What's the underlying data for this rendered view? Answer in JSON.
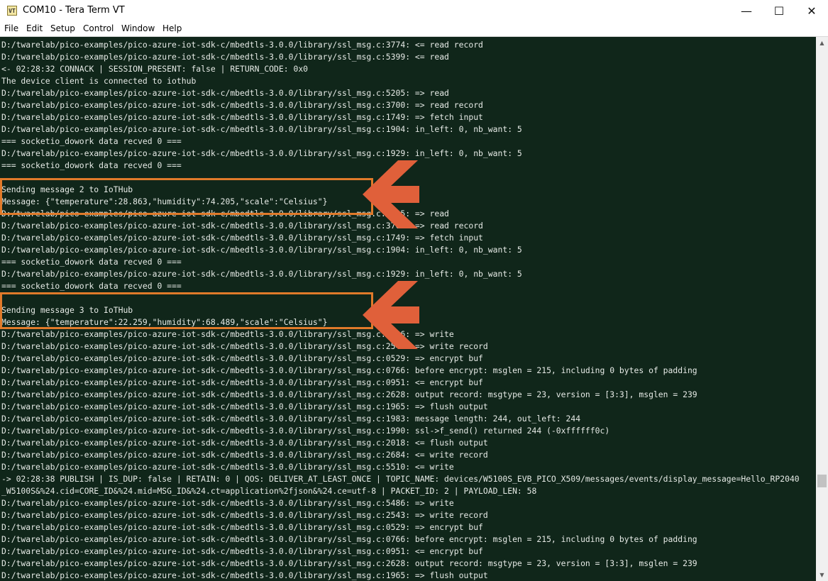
{
  "window": {
    "title": "COM10 - Tera Term VT",
    "icon_text": "VT",
    "minimize_glyph": "—",
    "maximize_glyph": "☐",
    "close_glyph": "✕"
  },
  "menu": {
    "file": "File",
    "edit": "Edit",
    "setup": "Setup",
    "control": "Control",
    "window": "Window",
    "help": "Help"
  },
  "terminal": {
    "lines": [
      "D:/twarelab/pico-examples/pico-azure-iot-sdk-c/mbedtls-3.0.0/library/ssl_msg.c:3774: <= read record",
      "D:/twarelab/pico-examples/pico-azure-iot-sdk-c/mbedtls-3.0.0/library/ssl_msg.c:5399: <= read",
      "<- 02:28:32 CONNACK | SESSION_PRESENT: false | RETURN_CODE: 0x0",
      "The device client is connected to iothub",
      "D:/twarelab/pico-examples/pico-azure-iot-sdk-c/mbedtls-3.0.0/library/ssl_msg.c:5205: => read",
      "D:/twarelab/pico-examples/pico-azure-iot-sdk-c/mbedtls-3.0.0/library/ssl_msg.c:3700: => read record",
      "D:/twarelab/pico-examples/pico-azure-iot-sdk-c/mbedtls-3.0.0/library/ssl_msg.c:1749: => fetch input",
      "D:/twarelab/pico-examples/pico-azure-iot-sdk-c/mbedtls-3.0.0/library/ssl_msg.c:1904: in_left: 0, nb_want: 5",
      "=== socketio_dowork data recved 0 ===",
      "D:/twarelab/pico-examples/pico-azure-iot-sdk-c/mbedtls-3.0.0/library/ssl_msg.c:1929: in_left: 0, nb_want: 5",
      "=== socketio_dowork data recved 0 ===",
      "",
      "Sending message 2 to IoTHub",
      "Message: {\"temperature\":28.863,\"humidity\":74.205,\"scale\":\"Celsius\"}",
      "D:/twarelab/pico-examples/pico-azure-iot-sdk-c/mbedtls-3.0.0/library/ssl_msg.c:5205: => read",
      "D:/twarelab/pico-examples/pico-azure-iot-sdk-c/mbedtls-3.0.0/library/ssl_msg.c:3700: => read record",
      "D:/twarelab/pico-examples/pico-azure-iot-sdk-c/mbedtls-3.0.0/library/ssl_msg.c:1749: => fetch input",
      "D:/twarelab/pico-examples/pico-azure-iot-sdk-c/mbedtls-3.0.0/library/ssl_msg.c:1904: in_left: 0, nb_want: 5",
      "=== socketio_dowork data recved 0 ===",
      "D:/twarelab/pico-examples/pico-azure-iot-sdk-c/mbedtls-3.0.0/library/ssl_msg.c:1929: in_left: 0, nb_want: 5",
      "=== socketio_dowork data recved 0 ===",
      "",
      "Sending message 3 to IoTHub",
      "Message: {\"temperature\":22.259,\"humidity\":68.489,\"scale\":\"Celsius\"}",
      "D:/twarelab/pico-examples/pico-azure-iot-sdk-c/mbedtls-3.0.0/library/ssl_msg.c:5486: => write",
      "D:/twarelab/pico-examples/pico-azure-iot-sdk-c/mbedtls-3.0.0/library/ssl_msg.c:2543: => write record",
      "D:/twarelab/pico-examples/pico-azure-iot-sdk-c/mbedtls-3.0.0/library/ssl_msg.c:0529: => encrypt buf",
      "D:/twarelab/pico-examples/pico-azure-iot-sdk-c/mbedtls-3.0.0/library/ssl_msg.c:0766: before encrypt: msglen = 215, including 0 bytes of padding",
      "D:/twarelab/pico-examples/pico-azure-iot-sdk-c/mbedtls-3.0.0/library/ssl_msg.c:0951: <= encrypt buf",
      "D:/twarelab/pico-examples/pico-azure-iot-sdk-c/mbedtls-3.0.0/library/ssl_msg.c:2628: output record: msgtype = 23, version = [3:3], msglen = 239",
      "D:/twarelab/pico-examples/pico-azure-iot-sdk-c/mbedtls-3.0.0/library/ssl_msg.c:1965: => flush output",
      "D:/twarelab/pico-examples/pico-azure-iot-sdk-c/mbedtls-3.0.0/library/ssl_msg.c:1983: message length: 244, out_left: 244",
      "D:/twarelab/pico-examples/pico-azure-iot-sdk-c/mbedtls-3.0.0/library/ssl_msg.c:1990: ssl->f_send() returned 244 (-0xffffff0c)",
      "D:/twarelab/pico-examples/pico-azure-iot-sdk-c/mbedtls-3.0.0/library/ssl_msg.c:2018: <= flush output",
      "D:/twarelab/pico-examples/pico-azure-iot-sdk-c/mbedtls-3.0.0/library/ssl_msg.c:2684: <= write record",
      "D:/twarelab/pico-examples/pico-azure-iot-sdk-c/mbedtls-3.0.0/library/ssl_msg.c:5510: <= write",
      "-> 02:28:38 PUBLISH | IS_DUP: false | RETAIN: 0 | QOS: DELIVER_AT_LEAST_ONCE | TOPIC_NAME: devices/W5100S_EVB_PICO_X509/messages/events/display_message=Hello_RP2040",
      "_W5100S&%24.cid=CORE_ID&%24.mid=MSG_ID&%24.ct=application%2fjson&%24.ce=utf-8 | PACKET_ID: 2 | PAYLOAD_LEN: 58",
      "D:/twarelab/pico-examples/pico-azure-iot-sdk-c/mbedtls-3.0.0/library/ssl_msg.c:5486: => write",
      "D:/twarelab/pico-examples/pico-azure-iot-sdk-c/mbedtls-3.0.0/library/ssl_msg.c:2543: => write record",
      "D:/twarelab/pico-examples/pico-azure-iot-sdk-c/mbedtls-3.0.0/library/ssl_msg.c:0529: => encrypt buf",
      "D:/twarelab/pico-examples/pico-azure-iot-sdk-c/mbedtls-3.0.0/library/ssl_msg.c:0766: before encrypt: msglen = 215, including 0 bytes of padding",
      "D:/twarelab/pico-examples/pico-azure-iot-sdk-c/mbedtls-3.0.0/library/ssl_msg.c:0951: <= encrypt buf",
      "D:/twarelab/pico-examples/pico-azure-iot-sdk-c/mbedtls-3.0.0/library/ssl_msg.c:2628: output record: msgtype = 23, version = [3:3], msglen = 239",
      "D:/twarelab/pico-examples/pico-azure-iot-sdk-c/mbedtls-3.0.0/library/ssl_msg.c:1965: => flush output"
    ]
  },
  "annotations": {
    "highlight_color": "#e07a2a",
    "arrow_color": "#e0603a"
  },
  "colors": {
    "terminal_bg": "#10261a",
    "terminal_fg": "#e6eae6"
  }
}
